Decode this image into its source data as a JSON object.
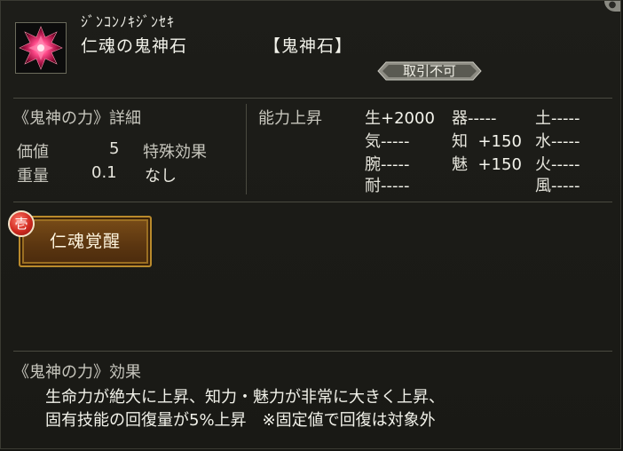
{
  "item": {
    "reading": "ｼﾞﾝｺﾝﾉｷｼﾞﾝｾｷ",
    "name": "仁魂の鬼神石",
    "category": "【鬼神石】",
    "trade_status": "取引不可"
  },
  "details": {
    "header": "《鬼神の力》詳細",
    "value_label": "価値",
    "value": "5",
    "weight_label": "重量",
    "weight": "0.1",
    "special_label": "特殊効果",
    "special_value": "なし"
  },
  "abilities": {
    "header": "能力上昇",
    "stats": [
      {
        "label": "生",
        "value": "+2000"
      },
      {
        "label": "器",
        "value": "-----"
      },
      {
        "label": "土",
        "value": "-----"
      },
      {
        "label": "気",
        "value": "-----"
      },
      {
        "label": "知",
        "value": "+150"
      },
      {
        "label": "水",
        "value": "-----"
      },
      {
        "label": "腕",
        "value": "-----"
      },
      {
        "label": "魅",
        "value": "+150"
      },
      {
        "label": "火",
        "value": "-----"
      },
      {
        "label": "耐",
        "value": "-----"
      },
      {
        "label": "風",
        "value": "-----"
      }
    ]
  },
  "awaken": {
    "badge": "壱",
    "label": "仁魂覚醒"
  },
  "effect": {
    "header": "《鬼神の力》効果",
    "line1": "生命力が絶大に上昇、知力・魅力が非常に大きく上昇、",
    "line2": "固有技能の回復量が5%上昇　※固定値で回復は対象外"
  },
  "colors": {
    "panel_bg": "#1d1d19",
    "button_gold": "#b98a2c",
    "badge_red": "#d02a20",
    "gem_red": "#d81850"
  },
  "icons": [
    "crystal-icon",
    "close-corner-icon"
  ]
}
